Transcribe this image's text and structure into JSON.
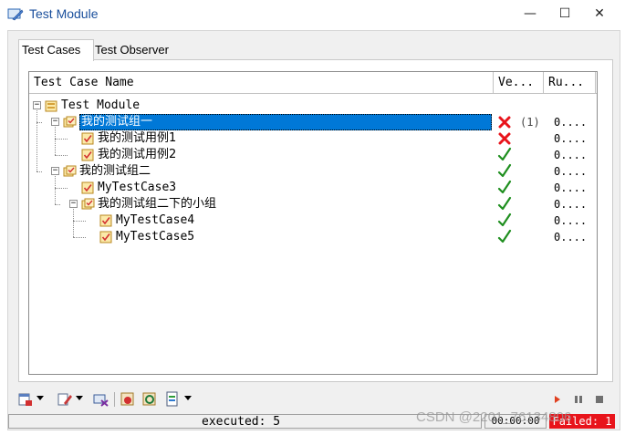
{
  "window": {
    "title": "Test Module",
    "controls": {
      "minimize": "—",
      "maximize": "☐",
      "close": "✕"
    }
  },
  "tabs": [
    {
      "label": "Test Cases",
      "active": true
    },
    {
      "label": "Test Observer",
      "active": false
    }
  ],
  "columns": {
    "name": "Test Case Name",
    "verdict": "Ve...",
    "runtime": "Ru..."
  },
  "tree": [
    {
      "name": "Test Module",
      "level": 0,
      "type": "module",
      "expander": "−",
      "verdict": "",
      "count": "",
      "runtime": ""
    },
    {
      "name": "我的测试组一",
      "level": 1,
      "type": "group",
      "expander": "−",
      "verdict": "fail",
      "count": "(1)",
      "runtime": "0....",
      "selected": true
    },
    {
      "name": "我的测试用例1",
      "level": 2,
      "type": "case",
      "expander": "",
      "verdict": "fail",
      "count": "",
      "runtime": "0...."
    },
    {
      "name": "我的测试用例2",
      "level": 2,
      "type": "case",
      "expander": "",
      "verdict": "pass",
      "count": "",
      "runtime": "0...."
    },
    {
      "name": "我的测试组二",
      "level": 1,
      "type": "group",
      "expander": "−",
      "verdict": "pass",
      "count": "",
      "runtime": "0...."
    },
    {
      "name": "MyTestCase3",
      "level": 2,
      "type": "case",
      "expander": "",
      "verdict": "pass",
      "count": "",
      "runtime": "0...."
    },
    {
      "name": "我的测试组二下的小组",
      "level": 2,
      "type": "group",
      "expander": "−",
      "verdict": "pass",
      "count": "",
      "runtime": "0...."
    },
    {
      "name": "MyTestCase4",
      "level": 3,
      "type": "case",
      "expander": "",
      "verdict": "pass",
      "count": "",
      "runtime": "0...."
    },
    {
      "name": "MyTestCase5",
      "level": 3,
      "type": "case",
      "expander": "",
      "verdict": "pass",
      "count": "",
      "runtime": "0...."
    }
  ],
  "status": {
    "executed": "executed: 5",
    "time": "00:00:00",
    "result": "Failed: 1"
  },
  "colors": {
    "accent": "#0078d7",
    "fail": "#e8141b",
    "pass": "#1f8f1f",
    "title": "#1a4f9c"
  },
  "watermark": "CSDN @2201_76134806"
}
